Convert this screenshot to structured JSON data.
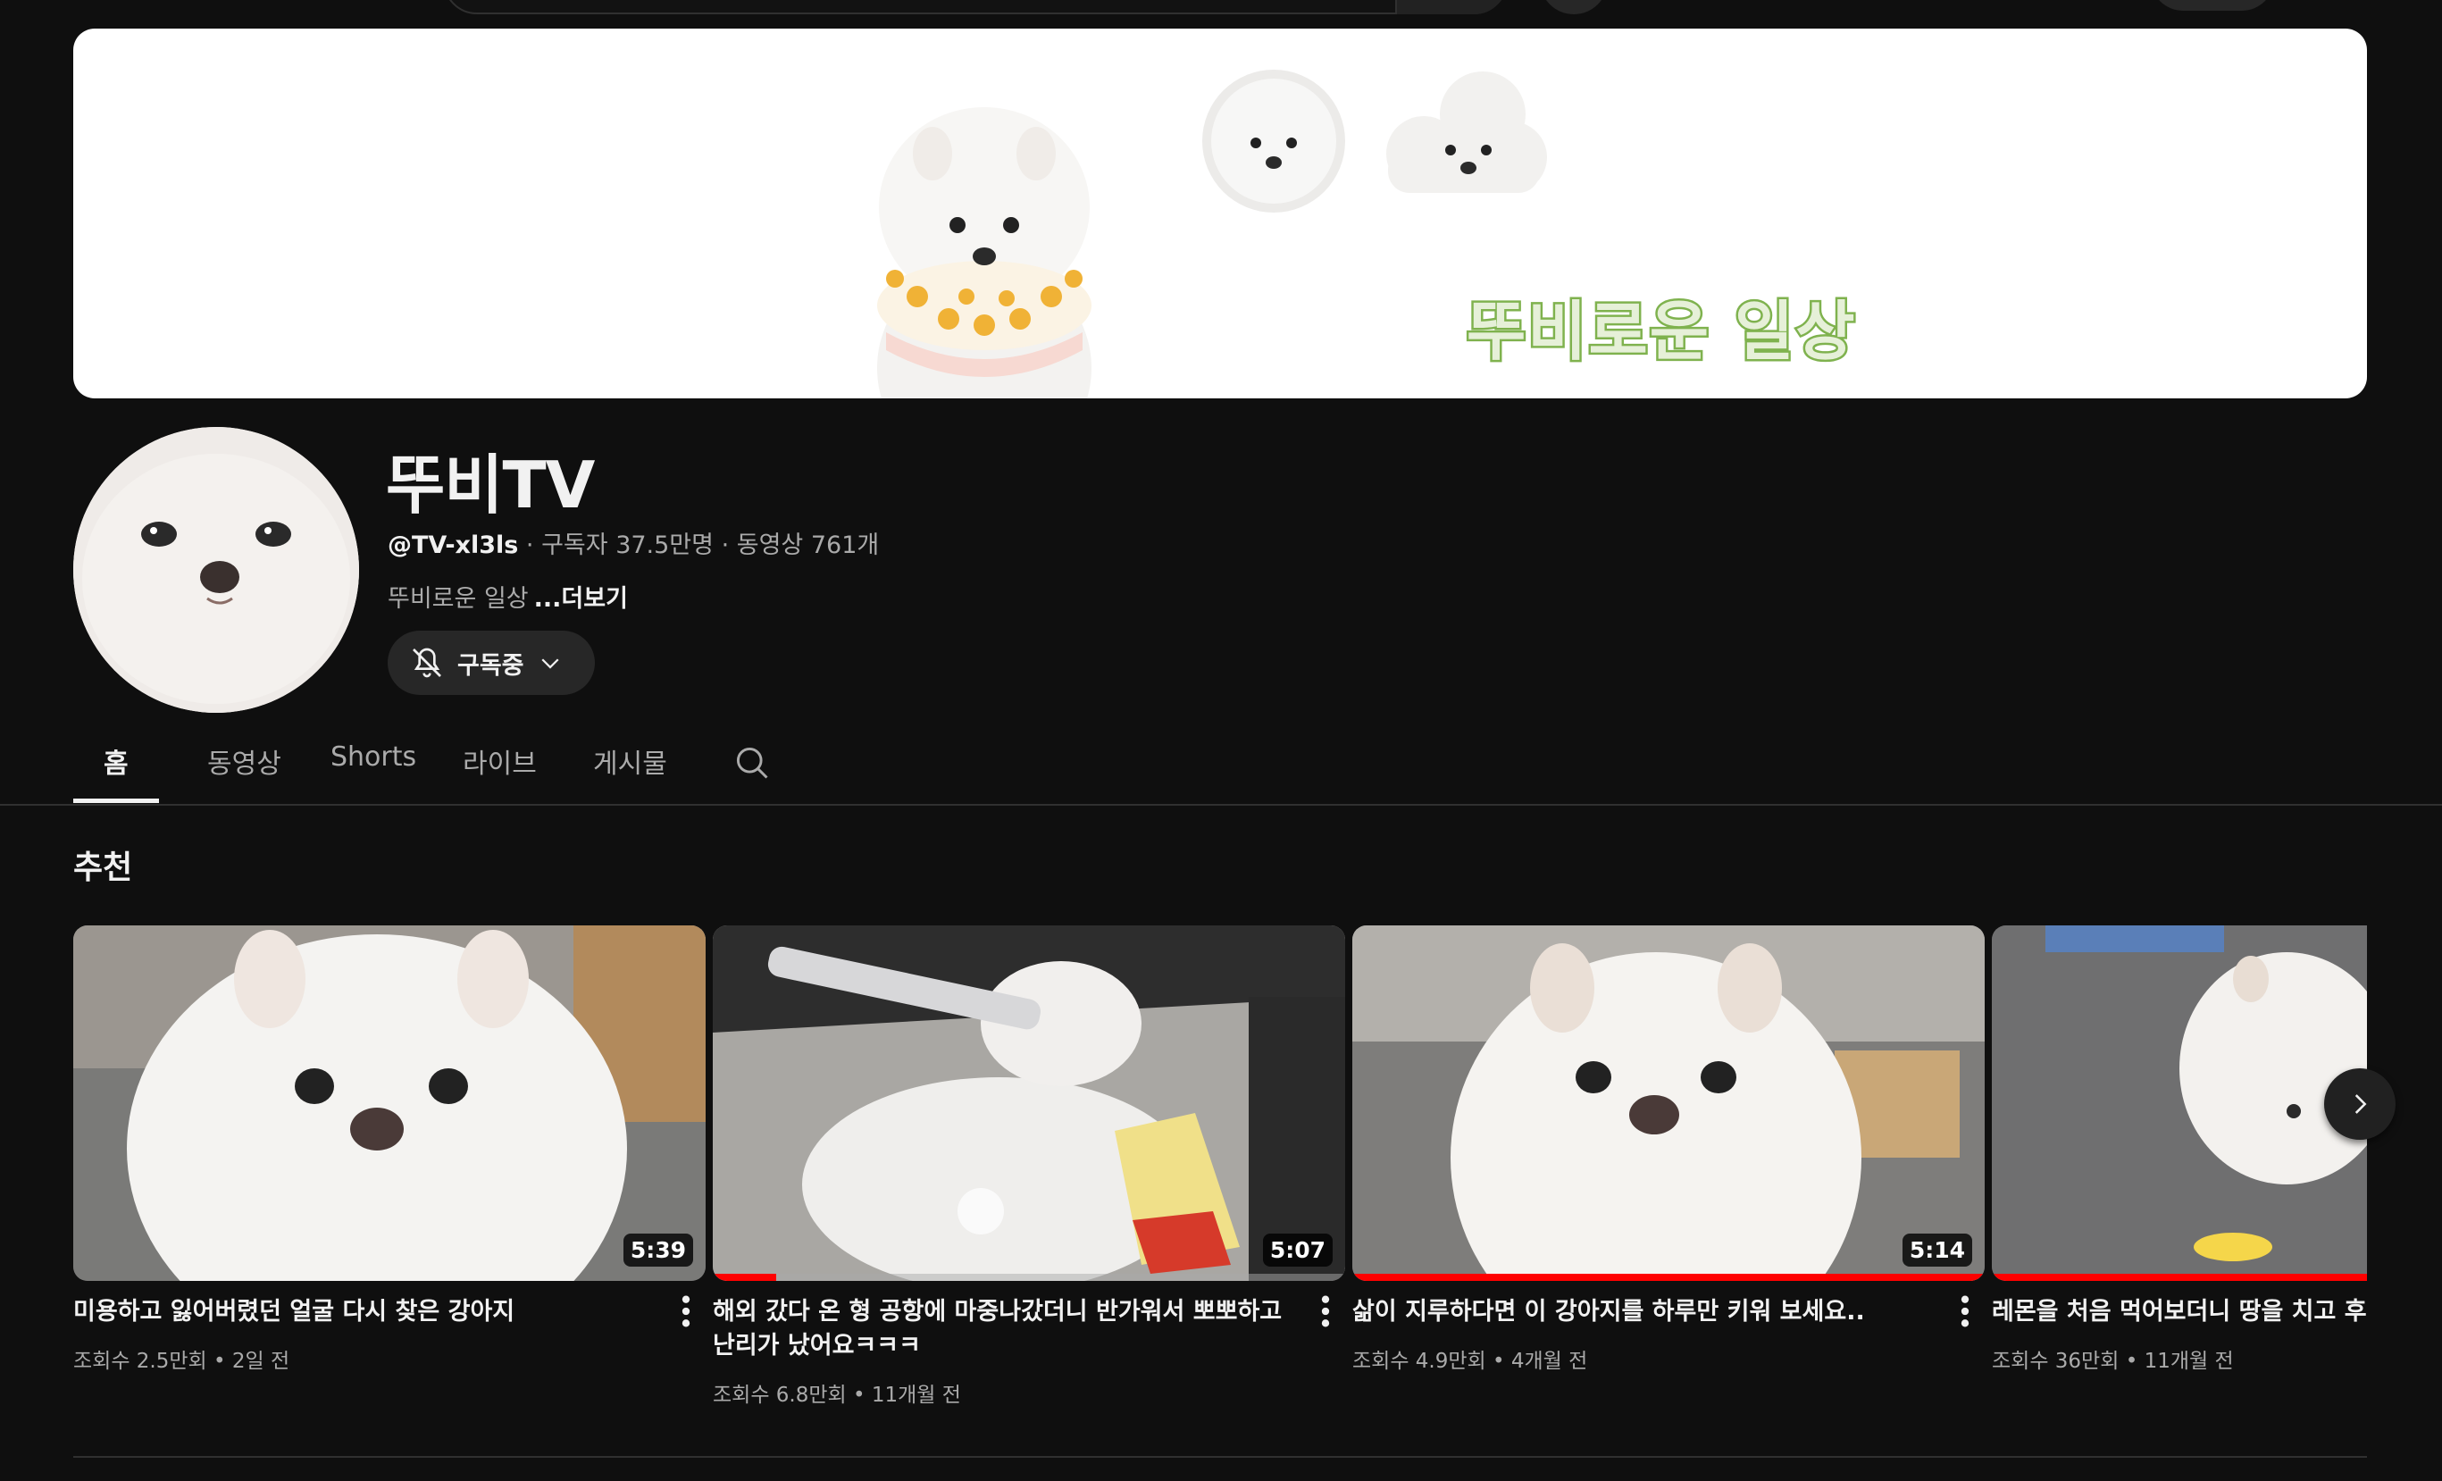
{
  "banner": {
    "text": "뚜비로운 일상"
  },
  "channel": {
    "name": "뚜비TV",
    "handle": "@TV-xl3ls",
    "stats": " · 구독자 37.5만명 · 동영상 761개",
    "description": "뚜비로운 일상",
    "more_label": "...더보기",
    "subscribe_label": "구독중"
  },
  "tabs": [
    {
      "label": "홈",
      "active": true
    },
    {
      "label": "동영상",
      "active": false
    },
    {
      "label": "Shorts",
      "active": false
    },
    {
      "label": "라이브",
      "active": false
    },
    {
      "label": "게시물",
      "active": false
    }
  ],
  "section": {
    "title": "추천"
  },
  "videos": [
    {
      "title": "미용하고 잃어버렸던 얼굴 다시 찾은 강아지",
      "meta": "조회수 2.5만회 • 2일 전",
      "duration": "5:39",
      "watched": 0
    },
    {
      "title": "해외 갔다 온 형 공항에 마중나갔더니 반가워서 뽀뽀하고 난리가 났어요ㅋㅋㅋ",
      "meta": "조회수 6.8만회 • 11개월 전",
      "duration": "5:07",
      "watched": 0.1
    },
    {
      "title": "삶이 지루하다면 이 강아지를 하루만 키워 보세요..",
      "meta": "조회수 4.9만회 • 4개월 전",
      "duration": "5:14",
      "watched": 1.0
    },
    {
      "title": "레몬을 처음 먹어보더니 땅을 치고 후회",
      "meta": "조회수 36만회 • 11개월 전",
      "duration": "",
      "watched": 1.0
    }
  ],
  "colors": {
    "background": "#0f0f0f",
    "banner_text_fill": "#e6f0d8",
    "banner_text_stroke": "#7fb24e",
    "progress": "#ff0000"
  }
}
